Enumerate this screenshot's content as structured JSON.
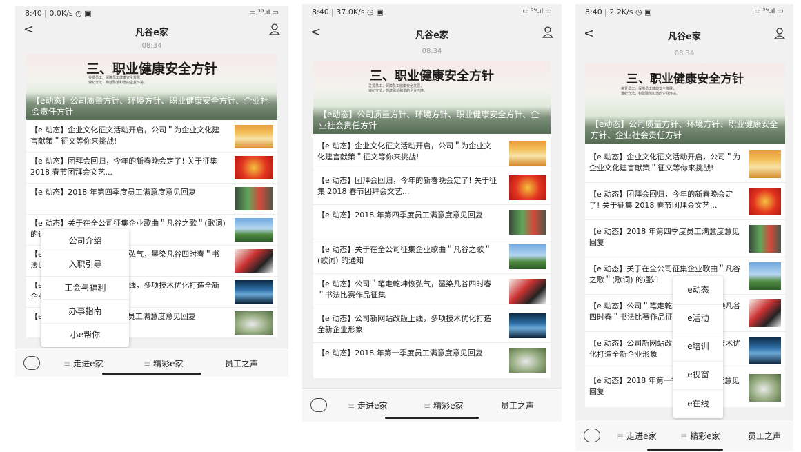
{
  "status": {
    "time": [
      "8:40 | 0.0K/s ◷ ▣",
      "8:40 | 37.0K/s ◷ ▣",
      "8:40 | 2.2K/s ◷ ▣"
    ],
    "right": "▭ ⁵ᴳ.ıl ▭"
  },
  "nav": {
    "back": "<",
    "title": "凡谷e家"
  },
  "time_label": "08:34",
  "banner": {
    "heading": "三、职业健康安全方针",
    "small_1": "关爱员工，保障员工健康安全发展，",
    "small_2": "遵纪守法，构建融洽和谐的企业环境。",
    "caption": "【e动态】公司质量方针、环境方针、职业健康安全方针、企业社会责任方针"
  },
  "articles": [
    "【e 动态】企业文化征文活动开启，公司＂为企业文化建言献策＂征文等你来挑战!",
    "【e 动态】团拜会回归，今年的新春晚会定了! 关于征集 2018 春节团拜会文艺...",
    "【e 动态】2018 年第四季度员工满意度意见回复",
    "【e 动态】关于在全公司征集企业歌曲＂凡谷之歌＂(歌词) 的通知",
    "【e 动态】公司＂笔走乾坤恢弘气，墨染凡谷四时春＂书法比赛作品征集",
    "【e 动态】公司新网站改版上线，多项技术优化打造全新企业形象",
    "【e 动态】2018 年第一季度员工满意度意见回复"
  ],
  "menu1": [
    "公司介绍",
    "入职引导",
    "工会与福利",
    "办事指南",
    "小e帮你"
  ],
  "menu3": [
    "e动态",
    "e活动",
    "e培训",
    "e视窗",
    "e在线"
  ],
  "tabs": {
    "tab1": "走进e家",
    "tab2": "精彩e家",
    "tab3": "员工之声",
    "grip": "≡"
  },
  "colors": {
    "background": "#f1f1f1",
    "card": "#ffffff",
    "banner_caption": "#ffffff"
  }
}
